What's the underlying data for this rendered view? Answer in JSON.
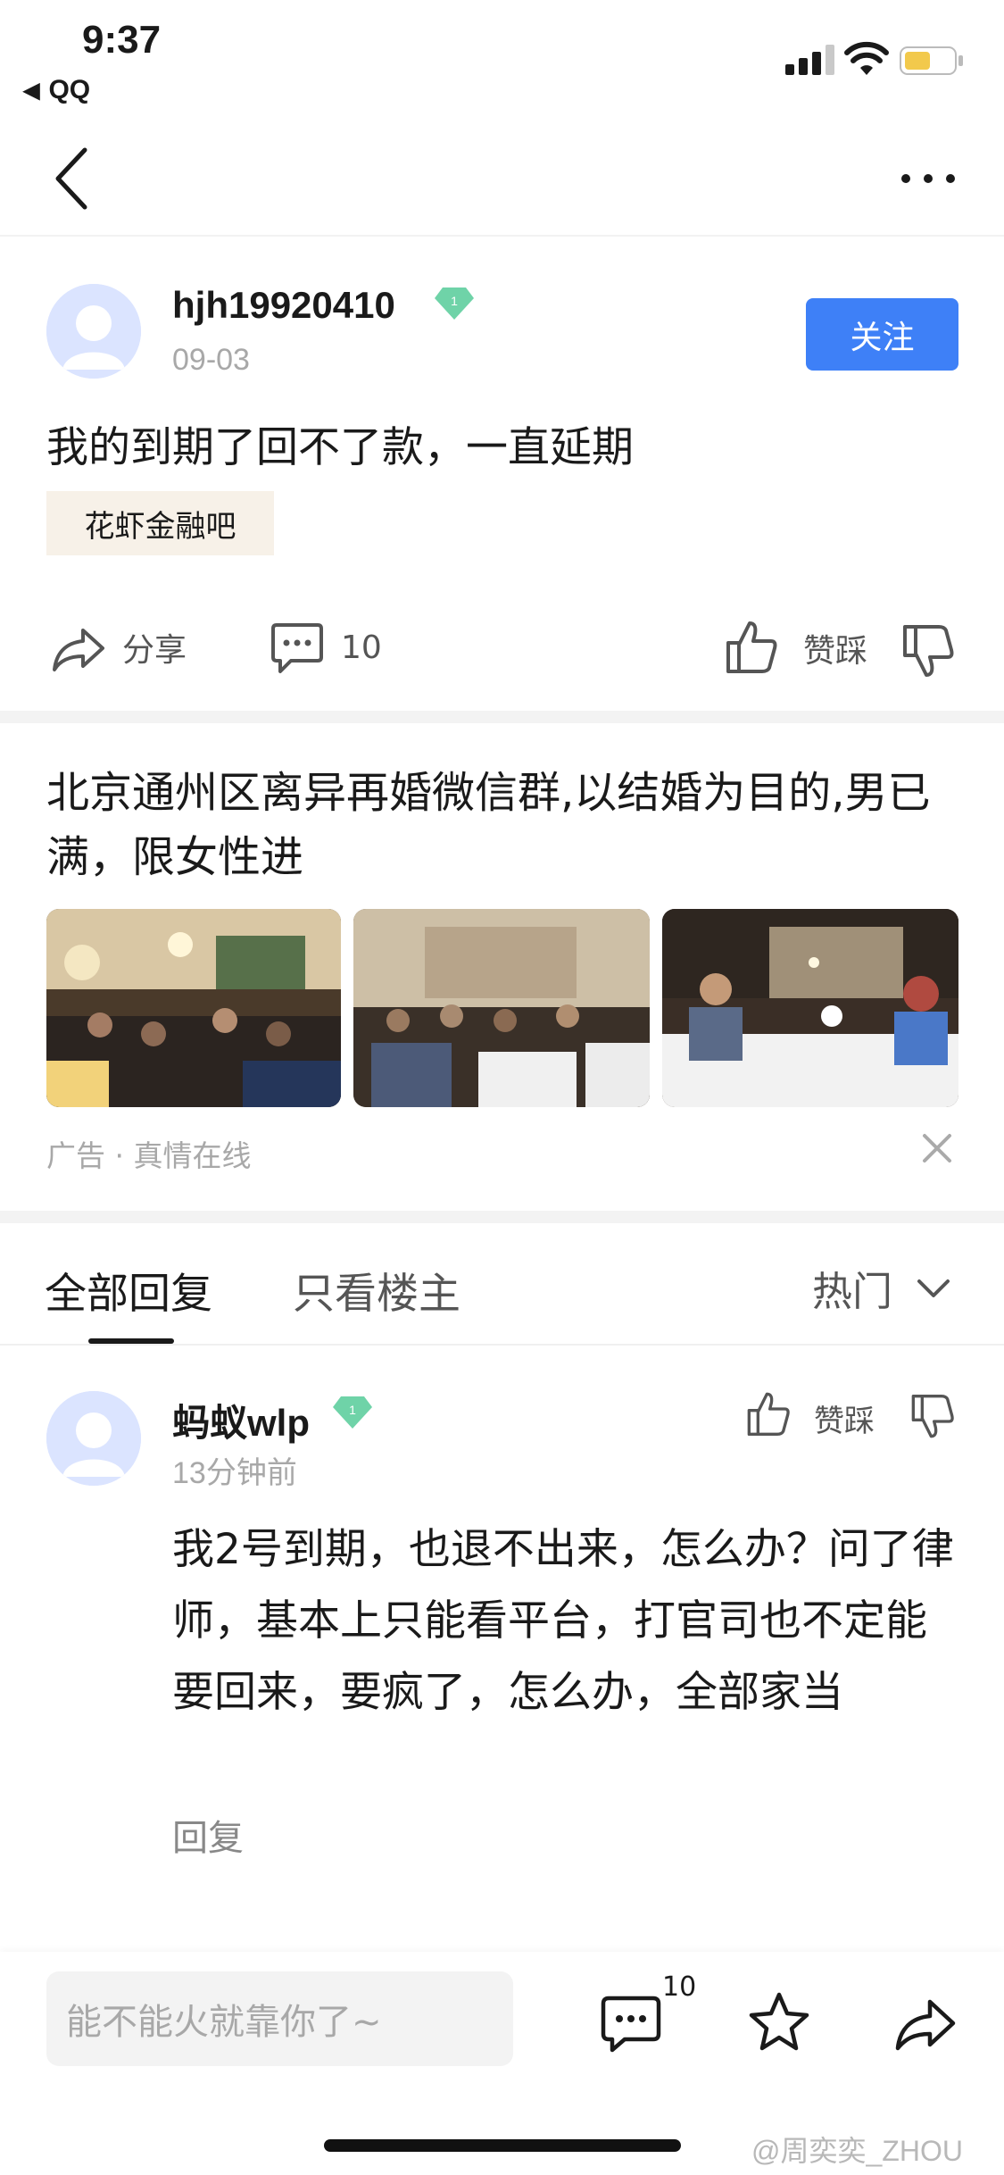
{
  "status_bar": {
    "time": "9:37",
    "back_app": "QQ",
    "back_arrow": "◀"
  },
  "post": {
    "username": "hjh19920410",
    "level": "1",
    "date": "09-03",
    "follow_label": "关注",
    "title": "我的到期了回不了款，一直延期",
    "forum_tag": "花虾金融吧"
  },
  "actions": {
    "share_label": "分享",
    "comment_count": "10",
    "vote_label": "赞踩"
  },
  "ad": {
    "title": "北京通州区离异再婚微信群,以结婚为目的,男已满，限女性进",
    "label": "广告 · 真情在线"
  },
  "tabs": {
    "all_replies": "全部回复",
    "op_only": "只看楼主",
    "sort": "热门"
  },
  "reply": {
    "username": "蚂蚁wlp",
    "level": "1",
    "time": "13分钟前",
    "vote_label": "赞踩",
    "text": "我2号到期，也退不出来，怎么办？问了律师，基本上只能看平台，打官司也不定能要回来，要疯了，怎么办，全部家当",
    "reply_label": "回复"
  },
  "bottom_bar": {
    "input_placeholder": "能不能火就靠你了~",
    "comment_badge": "10",
    "watermark": "@周奕奕_ZHOU"
  },
  "colors": {
    "accent": "#3e80f7",
    "tag_bg": "#f7f1e8",
    "vip_badge": "#6fd3a8"
  }
}
